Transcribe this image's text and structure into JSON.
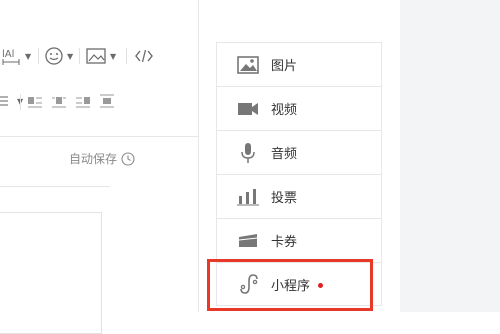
{
  "editor": {
    "autosave_label": "自动保存",
    "toolbar_row1": [
      "letter-spacing-icon",
      "emoji-icon",
      "image-icon",
      "code-icon"
    ],
    "toolbar_row2": [
      "list-icon",
      "align-left-icon",
      "align-center-icon",
      "align-right-icon",
      "align-justify-icon"
    ]
  },
  "insert_panel": {
    "items": [
      {
        "label": "图片",
        "icon": "picture-icon"
      },
      {
        "label": "视频",
        "icon": "video-icon"
      },
      {
        "label": "音频",
        "icon": "microphone-icon"
      },
      {
        "label": "投票",
        "icon": "vote-bars-icon"
      },
      {
        "label": "卡券",
        "icon": "card-icon"
      },
      {
        "label": "小程序",
        "icon": "mini-program-icon",
        "new_badge": true
      }
    ]
  },
  "colors": {
    "highlight": "#e83828",
    "badge": "#e02020",
    "border": "#e7e7eb"
  }
}
